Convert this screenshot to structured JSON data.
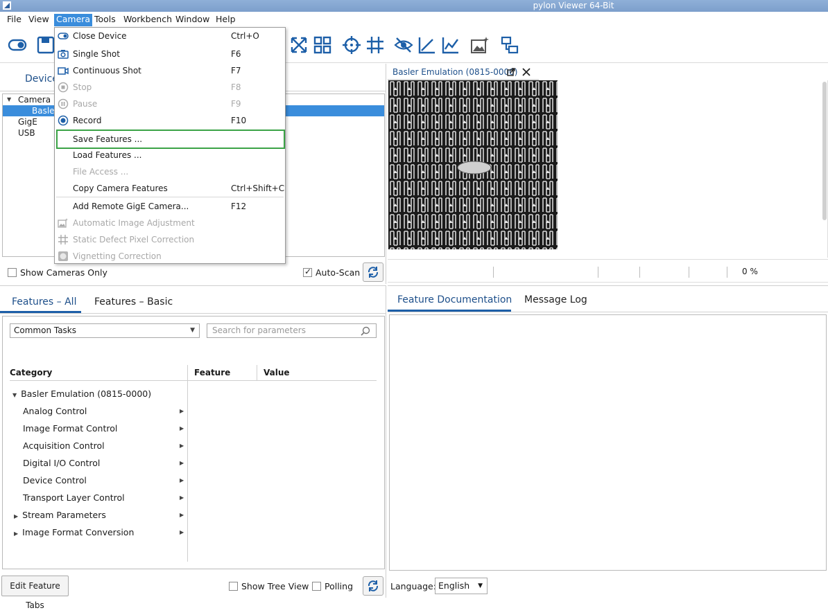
{
  "window": {
    "title": "pylon Viewer 64-Bit"
  },
  "menubar": {
    "items": [
      {
        "label": "File",
        "active": false
      },
      {
        "label": "View",
        "active": false
      },
      {
        "label": "Camera",
        "active": true
      },
      {
        "label": "Tools",
        "active": false
      },
      {
        "label": "Workbench",
        "active": false
      },
      {
        "label": "Window",
        "active": false
      },
      {
        "label": "Help",
        "active": false
      }
    ]
  },
  "camera_menu": {
    "items": [
      {
        "label": "Close Device",
        "shortcut": "Ctrl+O",
        "icon": "toggle-icon",
        "enabled": true
      },
      {
        "label": "Single Shot",
        "shortcut": "F6",
        "icon": "camera-icon",
        "enabled": true
      },
      {
        "label": "Continuous Shot",
        "shortcut": "F7",
        "icon": "video-camera-icon",
        "enabled": true
      },
      {
        "label": "Stop",
        "shortcut": "F8",
        "icon": "stop-icon",
        "enabled": false
      },
      {
        "label": "Pause",
        "shortcut": "F9",
        "icon": "pause-icon",
        "enabled": false
      },
      {
        "label": "Record",
        "shortcut": "F10",
        "icon": "record-icon",
        "enabled": true
      },
      {
        "label": "Save Features ...",
        "shortcut": "",
        "icon": "",
        "enabled": true,
        "hover": true
      },
      {
        "label": "Load Features ...",
        "shortcut": "",
        "icon": "",
        "enabled": true
      },
      {
        "label": "File Access ...",
        "shortcut": "",
        "icon": "",
        "enabled": false
      },
      {
        "label": "Copy Camera Features",
        "shortcut": "Ctrl+Shift+C",
        "icon": "",
        "enabled": true
      },
      {
        "label": "Add Remote GigE Camera...",
        "shortcut": "F12",
        "icon": "",
        "enabled": true
      },
      {
        "label": "Automatic Image Adjustment",
        "shortcut": "",
        "icon": "image-adjust-icon",
        "enabled": false
      },
      {
        "label": "Static Defect Pixel Correction",
        "shortcut": "",
        "icon": "grid-icon",
        "enabled": false
      },
      {
        "label": "Vignetting Correction",
        "shortcut": "",
        "icon": "vignetting-icon",
        "enabled": false
      }
    ]
  },
  "devices": {
    "tab_label": "Device",
    "tree": [
      {
        "label": "Camera Em",
        "level": 0,
        "expanded": true,
        "selected": false
      },
      {
        "label": "Basler",
        "level": 1,
        "selected": true
      },
      {
        "label": "GigE",
        "level": 0,
        "selected": false
      },
      {
        "label": "USB",
        "level": 0,
        "selected": false
      }
    ],
    "show_cameras_only": {
      "label": "Show Cameras Only",
      "checked": false
    },
    "auto_scan": {
      "label": "Auto-Scan",
      "checked": true
    }
  },
  "image_view": {
    "tab_label": "Basler Emulation (0815-0000)",
    "status_percent": "0 %"
  },
  "features": {
    "tabs": [
      {
        "label": "Features – All",
        "active": true
      },
      {
        "label": "Features – Basic",
        "active": false
      }
    ],
    "filter": {
      "value": "Common Tasks"
    },
    "search": {
      "placeholder": "Search for parameters"
    },
    "columns": [
      "Category",
      "Feature",
      "Value"
    ],
    "root": "Basler Emulation (0815-0000)",
    "categories": [
      {
        "label": "Analog Control",
        "expandable": false
      },
      {
        "label": "Image Format Control",
        "expandable": false
      },
      {
        "label": "Acquisition Control",
        "expandable": false
      },
      {
        "label": "Digital I/O Control",
        "expandable": false
      },
      {
        "label": "Device Control",
        "expandable": false
      },
      {
        "label": "Transport Layer Control",
        "expandable": false
      },
      {
        "label": "Stream Parameters",
        "expandable": true
      },
      {
        "label": "Image Format Conversion",
        "expandable": true
      }
    ],
    "edit_tabs_label": "Edit Feature Tabs",
    "show_tree_view": {
      "label": "Show Tree View",
      "checked": false
    },
    "polling": {
      "label": "Polling",
      "checked": false
    }
  },
  "docs": {
    "tabs": [
      {
        "label": "Feature Documentation",
        "active": true
      },
      {
        "label": "Message Log",
        "active": false
      }
    ],
    "language_label": "Language:",
    "language_value": "English"
  },
  "colors": {
    "accent": "#3a8ddc",
    "tab_text": "#1d4f8a",
    "hover_outline": "#3aa346"
  }
}
